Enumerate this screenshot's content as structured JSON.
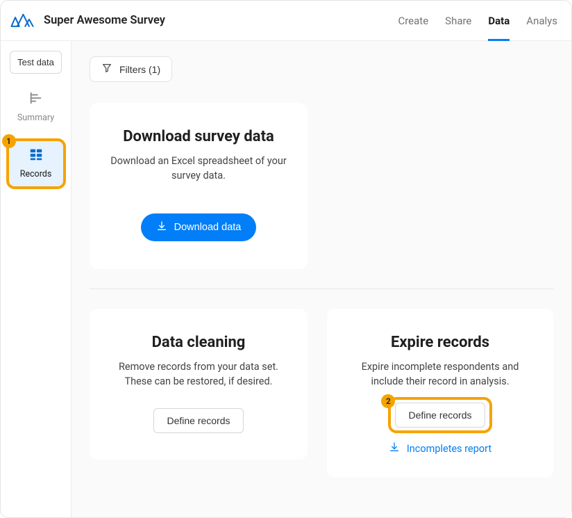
{
  "header": {
    "title": "Super Awesome Survey",
    "tabs": [
      "Create",
      "Share",
      "Data",
      "Analys"
    ]
  },
  "sidebar": {
    "test_data": "Test data",
    "summary": "Summary",
    "records": "Records"
  },
  "callouts": {
    "one": "1",
    "two": "2"
  },
  "filters": {
    "label": "Filters (1)"
  },
  "cards": {
    "download": {
      "title": "Download survey data",
      "desc": "Download an Excel spreadsheet of your survey data.",
      "button": "Download data"
    },
    "cleaning": {
      "title": "Data cleaning",
      "desc": "Remove records from your data set. These can be restored, if desired.",
      "button": "Define records"
    },
    "expire": {
      "title": "Expire records",
      "desc": "Expire incomplete respondents and include their record in analysis.",
      "button": "Define records",
      "link": "Incompletes report"
    }
  }
}
